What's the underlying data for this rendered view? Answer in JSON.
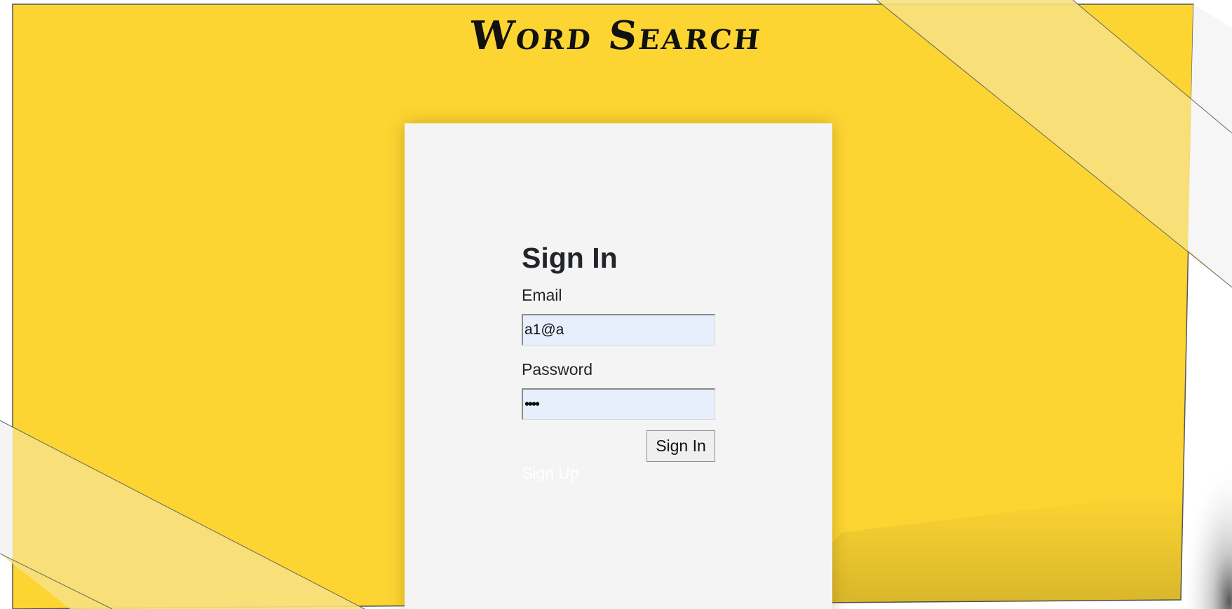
{
  "page": {
    "title": "Word Search"
  },
  "colors": {
    "paper_yellow": "#fdd532",
    "ribbon_light": "#f7e07e",
    "card_background": "#f4f4f4",
    "input_background": "#e8effc",
    "text_dark": "#222529",
    "signup_link": "#ffffff"
  },
  "signin_form": {
    "heading": "Sign In",
    "email_label": "Email",
    "email_value": "a1@a",
    "password_label": "Password",
    "password_value": "abcd",
    "submit_label": "Sign In",
    "signup_link": "Sign Up"
  }
}
